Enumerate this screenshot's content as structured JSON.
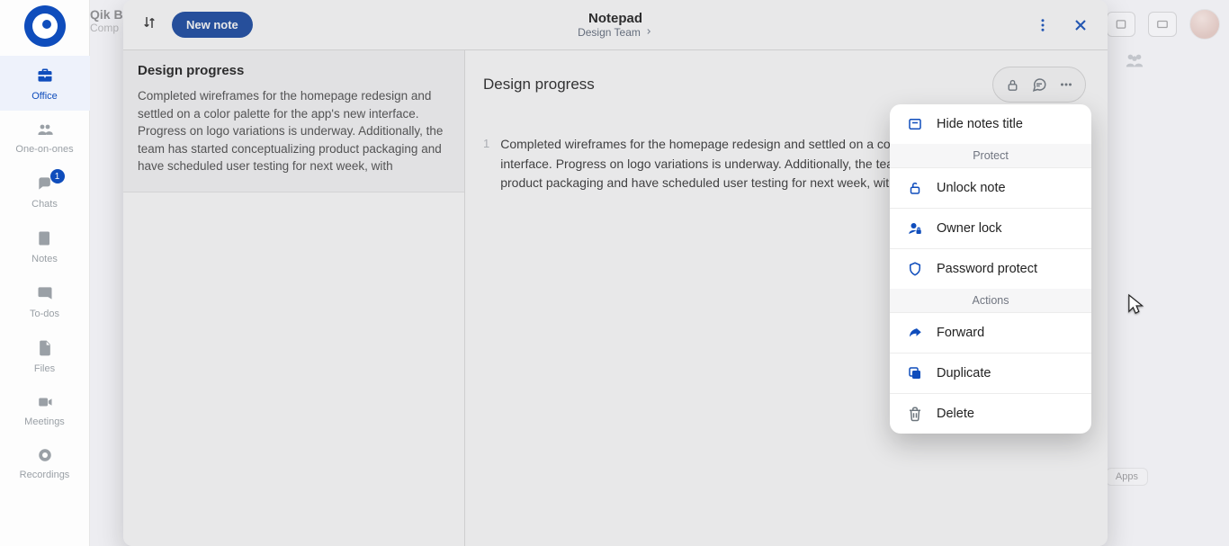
{
  "app": {
    "name": "Qik B",
    "subtitle": "Comp"
  },
  "sidebar": {
    "items": [
      {
        "label": "Office",
        "icon": "briefcase"
      },
      {
        "label": "One-on-ones",
        "icon": "people"
      },
      {
        "label": "Chats",
        "icon": "chat",
        "badge": "1"
      },
      {
        "label": "Notes",
        "icon": "notes"
      },
      {
        "label": "To-dos",
        "icon": "todos"
      },
      {
        "label": "Files",
        "icon": "files"
      },
      {
        "label": "Meetings",
        "icon": "meetings"
      },
      {
        "label": "Recordings",
        "icon": "record"
      }
    ]
  },
  "top_right": {
    "apps_label": "Apps"
  },
  "modal": {
    "header": {
      "new_note": "New note",
      "title": "Notepad",
      "subtitle": "Design Team"
    },
    "list": {
      "items": [
        {
          "title": "Design progress",
          "preview": "Completed wireframes for the homepage redesign and settled on a color palette for the app's new interface. Progress on logo variations is underway. Additionally, the team has started conceptualizing product packaging and have scheduled user testing for next week, with"
        }
      ]
    },
    "detail": {
      "title": "Design progress",
      "line_number": "1",
      "body": "Completed wireframes for the homepage redesign and settled on a color palette for the app's new interface. Progress on logo variations is underway. Additionally, the team has started conceptualizing product packaging and have scheduled user testing for next week, with prototypes in"
    }
  },
  "dropdown": {
    "hide_title": "Hide notes title",
    "section_protect": "Protect",
    "unlock": "Unlock note",
    "owner_lock": "Owner lock",
    "password_protect": "Password protect",
    "section_actions": "Actions",
    "forward": "Forward",
    "duplicate": "Duplicate",
    "delete": "Delete"
  }
}
